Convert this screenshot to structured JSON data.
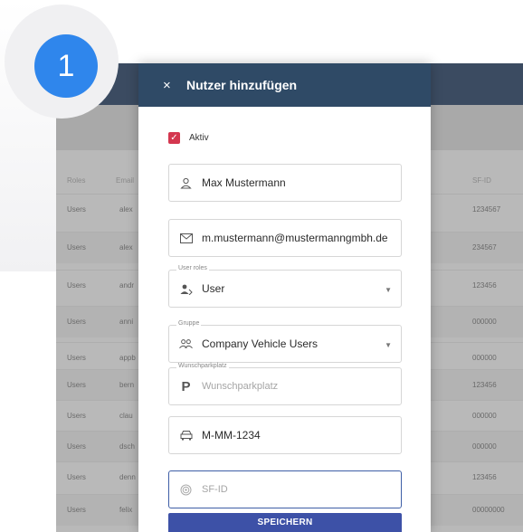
{
  "step": {
    "number": "1"
  },
  "table": {
    "columns": [
      "Roles",
      "Email",
      "SF-ID"
    ],
    "rows": [
      {
        "role": "Users",
        "email": "alex",
        "sfid": "1234567"
      },
      {
        "role": "Users",
        "email": "alex",
        "sfid": "234567"
      },
      {
        "role": "Users",
        "email": "andr",
        "sfid": "123456"
      },
      {
        "role": "Users",
        "email": "anni",
        "sfid": "000000"
      },
      {
        "role": "Users",
        "email": "appb",
        "sfid": "000000"
      },
      {
        "role": "Users",
        "email": "bern",
        "sfid": "123456"
      },
      {
        "role": "Users",
        "email": "clau",
        "sfid": "000000"
      },
      {
        "role": "Users",
        "email": "dsch",
        "sfid": "000000"
      },
      {
        "role": "Users",
        "email": "denn",
        "sfid": "123456"
      },
      {
        "role": "Users",
        "email": "felix",
        "sfid": "00000000"
      }
    ]
  },
  "modal": {
    "title": "Nutzer hinzufügen",
    "close_icon": "×",
    "active_label": "Aktiv",
    "name_value": "Max Mustermann",
    "email_value": "m.mustermann@mustermanngmbh.de",
    "roles_label": "User roles",
    "roles_value": "User",
    "group_label": "Gruppe",
    "group_value": "Company Vehicle Users",
    "parking_label": "Wunschparkplatz",
    "parking_placeholder": "Wunschparkplatz",
    "plate_value": "M-MM-1234",
    "sfid_placeholder": "SF-ID",
    "save_label": "SPEICHERN"
  },
  "colors": {
    "header": "#2f4a66",
    "checkbox": "#d4374f",
    "button": "#3d51a7",
    "badge": "#2f86ec"
  }
}
